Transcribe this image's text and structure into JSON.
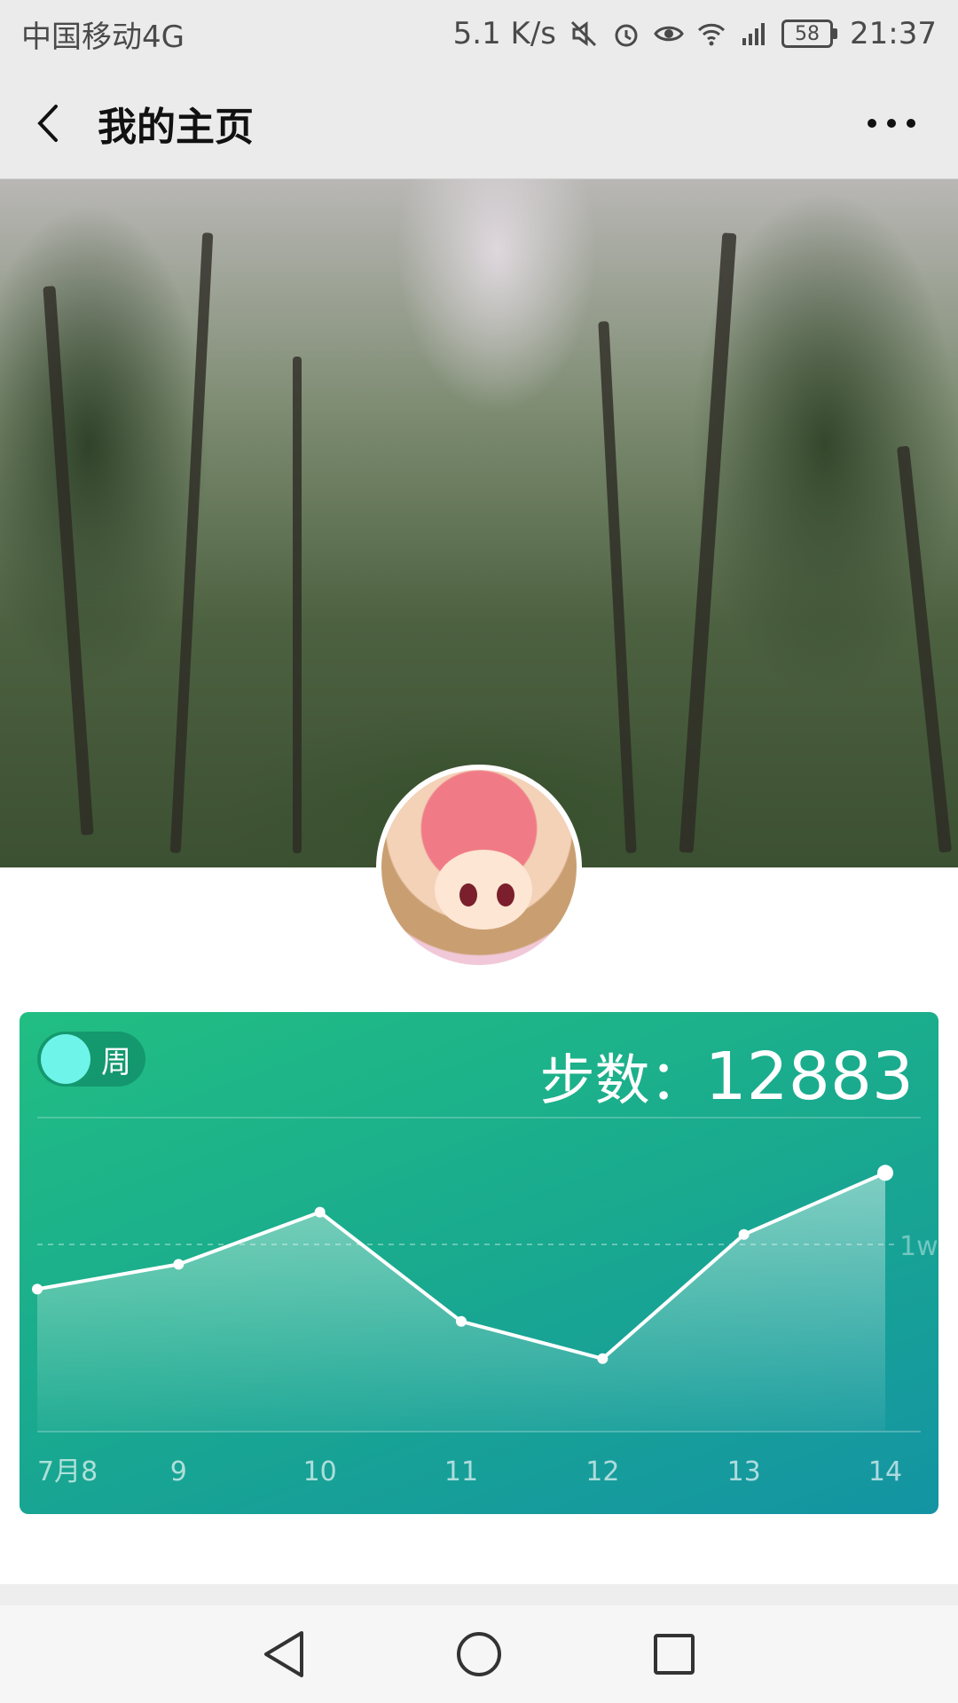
{
  "status_bar": {
    "carrier": "中国移动4G",
    "net_speed": "5.1 K/s",
    "battery": "58",
    "time": "21:37"
  },
  "nav": {
    "title": "我的主页"
  },
  "steps_card": {
    "toggle_label": "周",
    "steps_label": "步数：",
    "steps_value": "12883"
  },
  "chart_data": {
    "type": "area",
    "categories": [
      "7月8",
      "9",
      "10",
      "11",
      "12",
      "13",
      "14"
    ],
    "values": [
      8200,
      9200,
      11300,
      6900,
      5400,
      10400,
      12883
    ],
    "reference_line": {
      "label": "1w",
      "value": 10000
    },
    "ylim": [
      2500,
      14000
    ]
  },
  "colors": {
    "card_start": "#21be83",
    "card_end": "#1494a3",
    "toggle_knob": "#6ff4ea"
  }
}
